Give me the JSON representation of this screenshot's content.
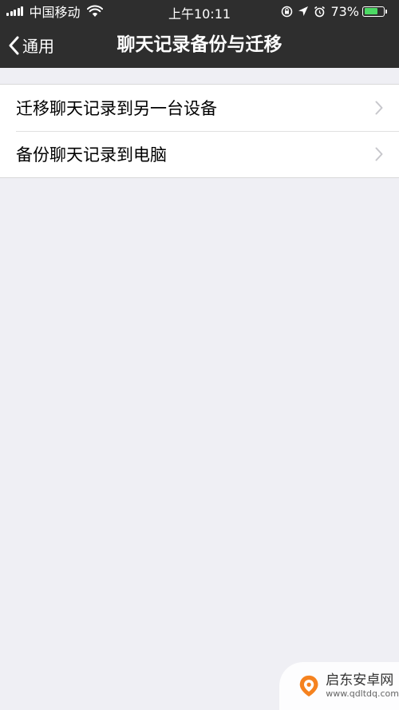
{
  "status_bar": {
    "carrier": "中国移动",
    "time": "上午10:11",
    "battery_percent": "73%",
    "battery_level": 0.73,
    "icons": [
      "signal-icon",
      "wifi-icon",
      "rotation-lock-icon",
      "location-icon",
      "alarm-icon",
      "battery-icon"
    ]
  },
  "nav": {
    "back_label": "通用",
    "title": "聊天记录备份与迁移",
    "background": "#2e2e2e"
  },
  "list": {
    "items": [
      {
        "label": "迁移聊天记录到另一台设备",
        "icon": "chevron-right-icon"
      },
      {
        "label": "备份聊天记录到电脑",
        "icon": "chevron-right-icon"
      }
    ]
  },
  "watermark": {
    "title": "启东安卓网",
    "url": "www.qdltdq.com",
    "accent": "#f5821f"
  },
  "colors": {
    "page_background": "#efeff4",
    "list_background": "#ffffff",
    "battery_fill": "#4cd964"
  }
}
